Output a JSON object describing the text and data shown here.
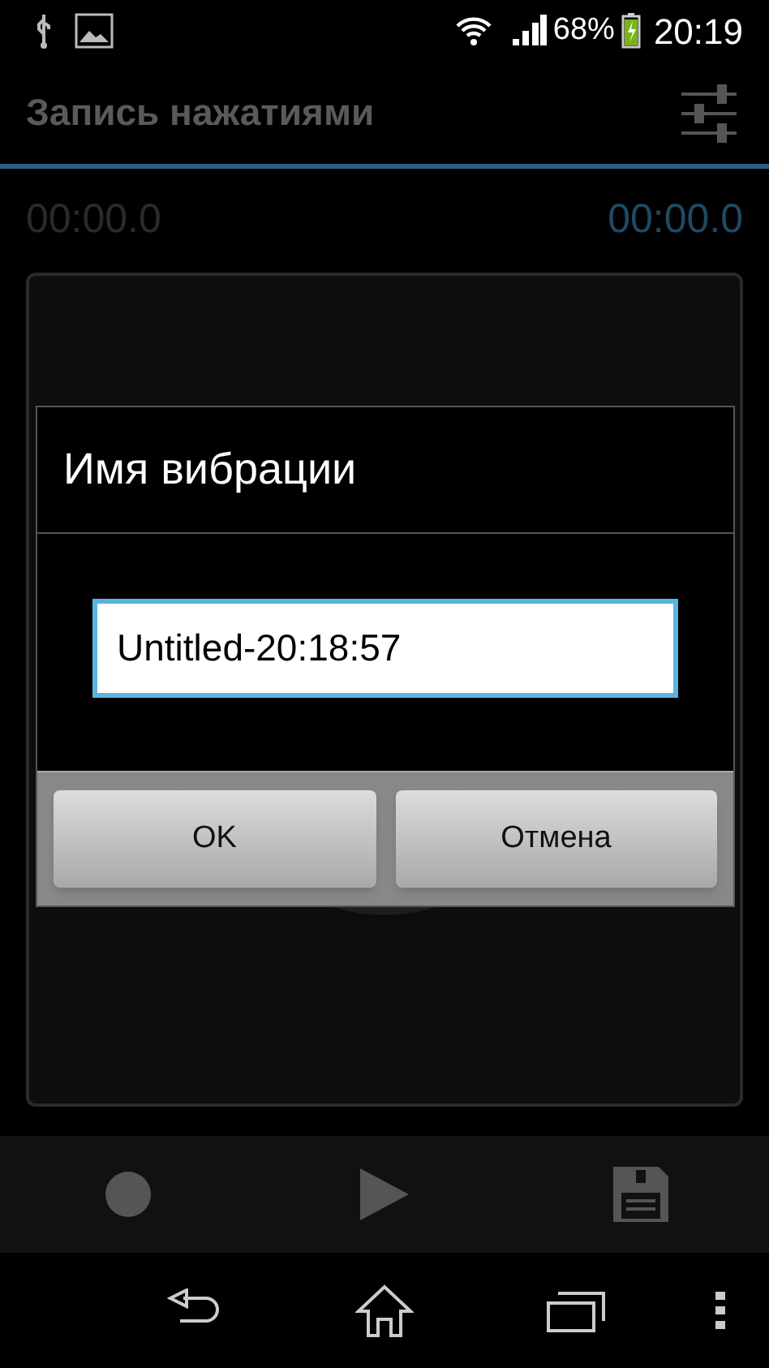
{
  "status_bar": {
    "battery": "68%",
    "time": "20:19"
  },
  "action_bar": {
    "title": "Запись нажатиями"
  },
  "timers": {
    "elapsed": "00:00.0",
    "total": "00:00.0"
  },
  "dialog": {
    "title": "Имя вибрации",
    "value": "Untitled-20:18:57",
    "buttons": [
      "OK",
      "Отмена"
    ]
  }
}
